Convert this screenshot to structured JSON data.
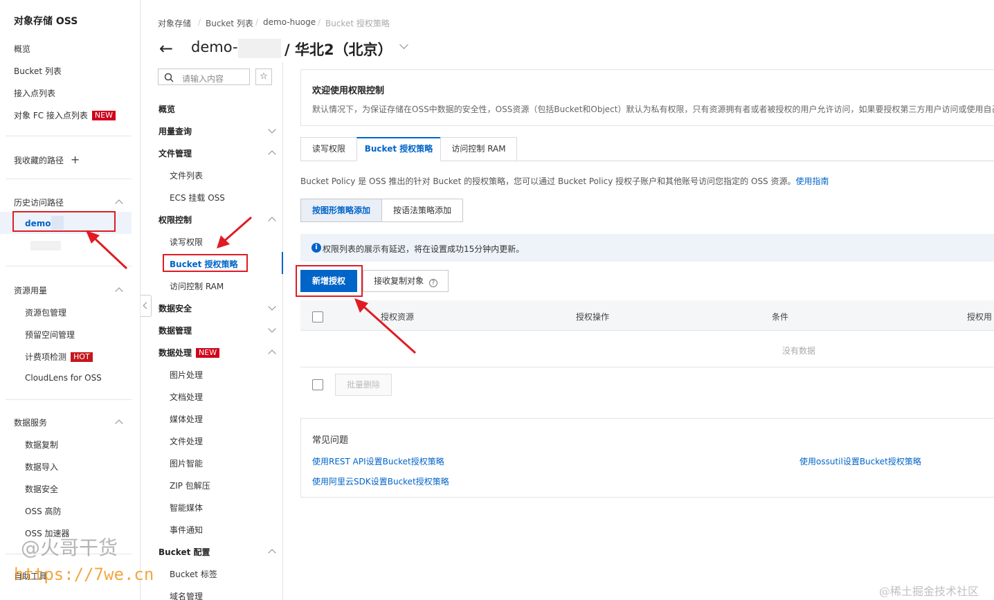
{
  "left_nav": {
    "title": "对象存储 OSS",
    "items": {
      "overview": "概览",
      "bucket_list": "Bucket 列表",
      "access_point_list": "接入点列表",
      "fc_access_point_list": "对象 FC 接入点列表",
      "fc_badge": "NEW",
      "favorite_paths": "我收藏的路径",
      "favorite_add": "+",
      "history_paths": "历史访问路径",
      "history_item": "demo-",
      "resource_usage": "资源用量",
      "resource_pack": "资源包管理",
      "reserved_space": "预留空间管理",
      "billing_check": "计费项检测",
      "billing_badge": "HOT",
      "cloudlens": "CloudLens for OSS",
      "data_services": "数据服务",
      "data_replication": "数据复制",
      "data_import": "数据导入",
      "data_security": "数据安全",
      "oss_ddos": "OSS 高防",
      "oss_accelerator": "OSS 加速器",
      "self_tools": "自助工具"
    }
  },
  "header": {
    "breadcrumb": [
      "对象存储",
      "Bucket 列表",
      "demo-huoge",
      "Bucket 授权策略"
    ],
    "bucket_name": "demo-",
    "region": "/ 华北2（北京）"
  },
  "sec_nav": {
    "search_placeholder": "请输入内容",
    "items": {
      "overview": "概览",
      "usage_query": "用量查询",
      "file_mgmt": "文件管理",
      "file_list": "文件列表",
      "ecs_mount": "ECS 挂载 OSS",
      "permission_ctrl": "权限控制",
      "rw_permission": "读写权限",
      "bucket_policy": "Bucket 授权策略",
      "access_ram": "访问控制 RAM",
      "data_security": "数据安全",
      "data_mgmt": "数据管理",
      "data_processing": "数据处理",
      "data_processing_badge": "NEW",
      "image_processing": "图片处理",
      "doc_processing": "文档处理",
      "media_processing": "媒体处理",
      "file_processing": "文件处理",
      "image_ai": "图片智能",
      "zip_decompress": "ZIP 包解压",
      "smart_media": "智能媒体",
      "event_notify": "事件通知",
      "bucket_config": "Bucket 配置",
      "bucket_tags": "Bucket 标签",
      "domain_mgmt": "域名管理"
    }
  },
  "main": {
    "welcome_title": "欢迎使用权限控制",
    "welcome_desc": "默认情况下，为保证存储在OSS中数据的安全性，OSS资源（包括Bucket和Object）默认为私有权限，只有资源拥有者或者被授权的用户允许访问，如果要授权第三方用户访问或使用自己的",
    "tabs": [
      "读写权限",
      "Bucket 授权策略",
      "访问控制 RAM"
    ],
    "policy_desc": "Bucket Policy 是 OSS 推出的针对 Bucket 的授权策略，您可以通过 Bucket Policy 授权子账户和其他账号访问您指定的 OSS 资源。",
    "policy_guide_link": "使用指南",
    "mode_buttons": [
      "按图形策略添加",
      "按语法策略添加"
    ],
    "notice": "权限列表的展示有延迟，将在设置成功15分钟内更新。",
    "add_button": "新增授权",
    "receive_copy_button": "接收复制对象",
    "table_headers": [
      "授权资源",
      "授权操作",
      "条件",
      "授权用"
    ],
    "empty_text": "没有数据",
    "batch_delete": "批量删除",
    "faq_title": "常见问题",
    "faq_links": [
      "使用REST API设置Bucket授权策略",
      "使用ossutil设置Bucket授权策略",
      "使用阿里云SDK设置Bucket授权策略"
    ]
  },
  "watermarks": {
    "author": "@火哥干货",
    "site": "https://7we.cn",
    "community": "@稀土掘金技术社区"
  },
  "colors": {
    "accent_blue": "#0064c8",
    "annotation_red": "#e01b24",
    "badge_red": "#d0021b"
  }
}
